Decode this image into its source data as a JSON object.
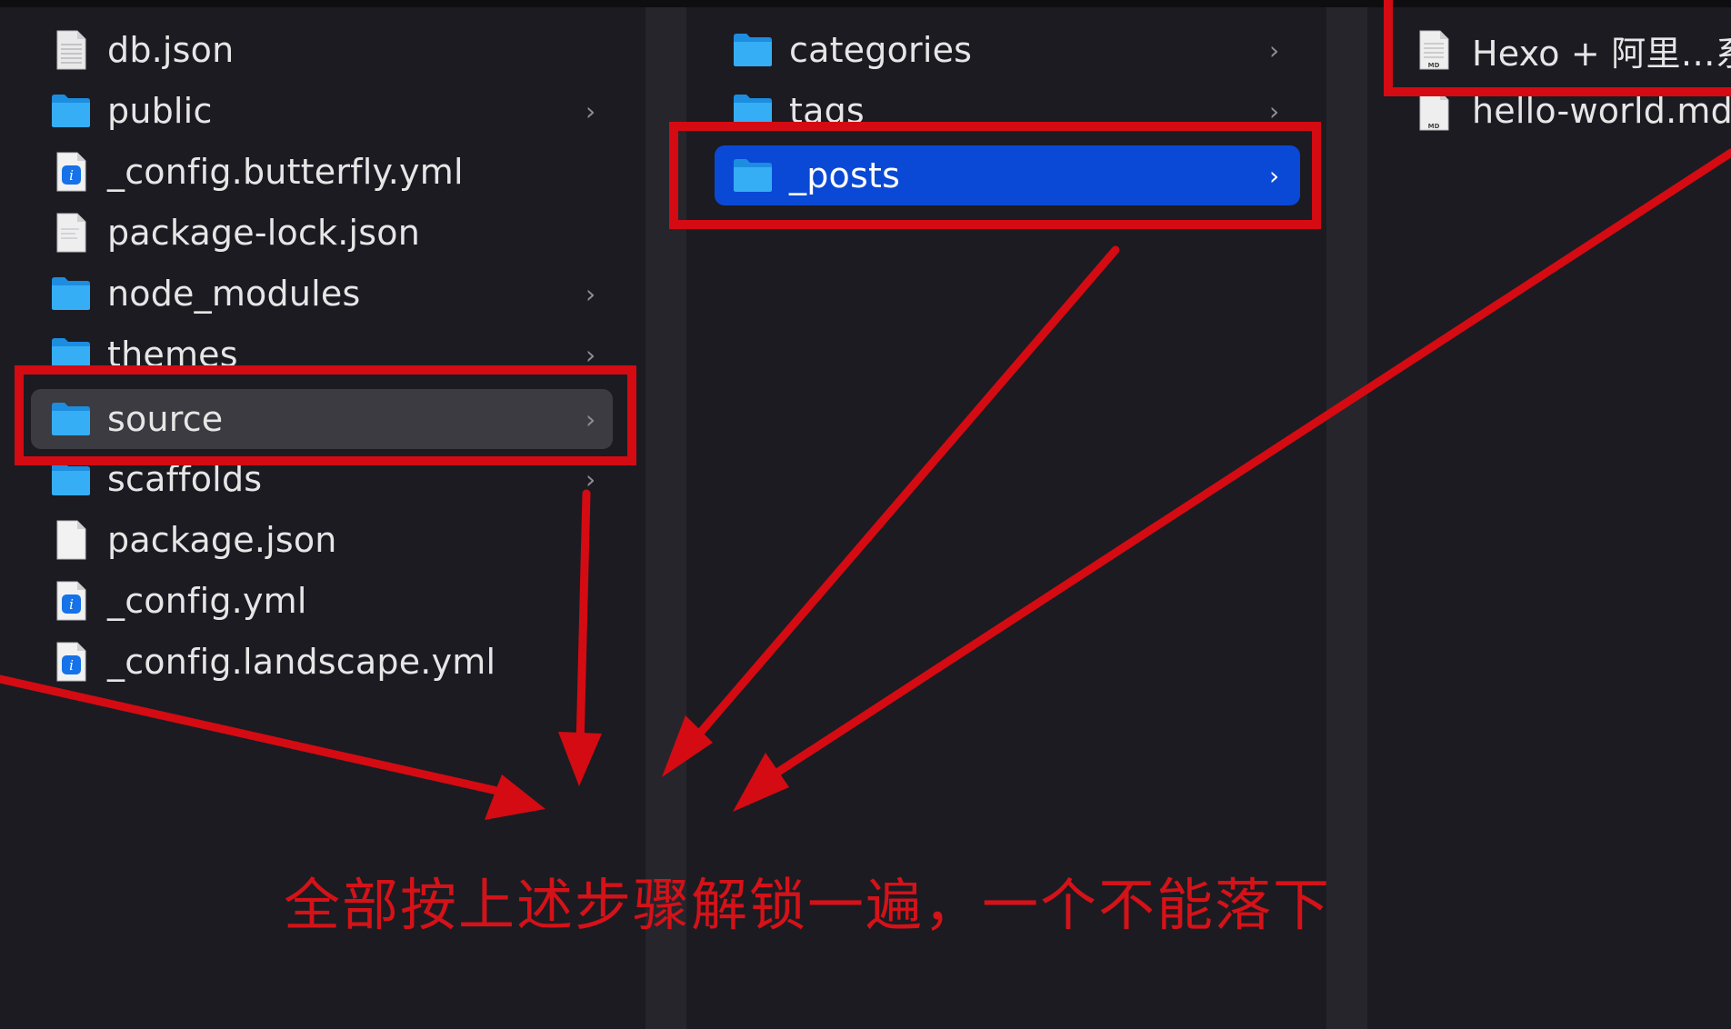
{
  "columns": {
    "root": {
      "items": [
        {
          "label": "db.json",
          "icon": "document-icon",
          "has_children": false
        },
        {
          "label": "public",
          "icon": "folder-icon",
          "has_children": true
        },
        {
          "label": "_config.butterfly.yml",
          "icon": "yml-file-icon",
          "has_children": false
        },
        {
          "label": "package-lock.json",
          "icon": "document-icon",
          "has_children": false
        },
        {
          "label": "node_modules",
          "icon": "folder-icon",
          "has_children": true
        },
        {
          "label": "themes",
          "icon": "folder-icon",
          "has_children": true
        },
        {
          "label": "source",
          "icon": "folder-icon",
          "has_children": true,
          "selected": true
        },
        {
          "label": "scaffolds",
          "icon": "folder-icon",
          "has_children": true
        },
        {
          "label": "package.json",
          "icon": "document-icon",
          "has_children": false
        },
        {
          "label": "_config.yml",
          "icon": "yml-file-icon",
          "has_children": false
        },
        {
          "label": "_config.landscape.yml",
          "icon": "yml-file-icon",
          "has_children": false
        }
      ]
    },
    "source": {
      "items": [
        {
          "label": "categories",
          "icon": "folder-icon",
          "has_children": true
        },
        {
          "label": "tags",
          "icon": "folder-icon",
          "has_children": true
        },
        {
          "label": "_posts",
          "icon": "folder-icon",
          "has_children": true,
          "selected": true
        }
      ]
    },
    "posts": {
      "items": [
        {
          "label": "Hexo + 阿里…系",
          "icon": "markdown-file-icon"
        },
        {
          "label": "hello-world.md",
          "icon": "markdown-file-icon"
        }
      ]
    }
  },
  "chevron": "›",
  "annotation": {
    "text": "全部按上述步骤解锁一遍，一个不能落下",
    "color": "#d40b12"
  },
  "colors": {
    "background": "#1c1b22",
    "selection_blue": "#0a49d5",
    "selection_gray": "#3c3b41",
    "folder_blue": "#2fa8f0",
    "annotation_red": "#d40b12"
  }
}
